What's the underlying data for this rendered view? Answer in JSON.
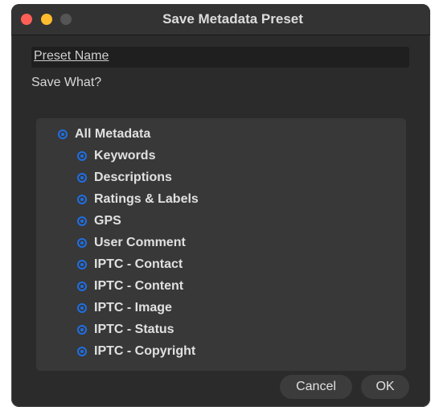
{
  "window": {
    "title": "Save Metadata Preset"
  },
  "preset": {
    "placeholder": "Preset Name",
    "value": ""
  },
  "save_what_label": "Save What?",
  "options": [
    {
      "label": "All Metadata",
      "selected": true
    },
    {
      "label": "Keywords",
      "selected": true
    },
    {
      "label": "Descriptions",
      "selected": true
    },
    {
      "label": "Ratings & Labels",
      "selected": true
    },
    {
      "label": "GPS",
      "selected": true
    },
    {
      "label": "User Comment",
      "selected": true
    },
    {
      "label": "IPTC - Contact",
      "selected": true
    },
    {
      "label": "IPTC - Content",
      "selected": true
    },
    {
      "label": "IPTC - Image",
      "selected": true
    },
    {
      "label": "IPTC - Status",
      "selected": true
    },
    {
      "label": "IPTC - Copyright",
      "selected": true
    }
  ],
  "buttons": {
    "cancel": "Cancel",
    "ok": "OK"
  },
  "colors": {
    "accent": "#1f6fe5",
    "window_bg": "#2b2b2b",
    "panel_bg": "#383838",
    "close": "#ff5f57",
    "minimize": "#febc2e",
    "zoom_disabled": "#555555"
  }
}
